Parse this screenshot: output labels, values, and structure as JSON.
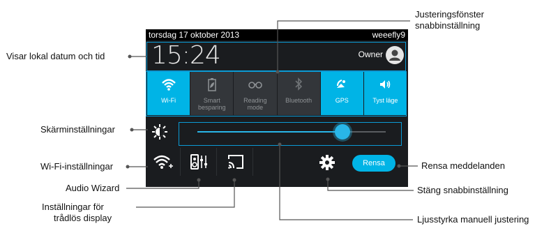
{
  "status_bar": {
    "date": "torsdag 17 oktober 2013",
    "network": "weeefly9"
  },
  "header": {
    "time": "15:24",
    "user": "Owner"
  },
  "tiles": [
    {
      "label": "Wi-Fi",
      "on": true,
      "icon": "wifi-icon"
    },
    {
      "label": "Smart besparing",
      "on": false,
      "icon": "battery-leaf-icon"
    },
    {
      "label": "Reading mode",
      "on": false,
      "icon": "glasses-icon"
    },
    {
      "label": "Bluetooth",
      "on": false,
      "icon": "bluetooth-icon"
    },
    {
      "label": "GPS",
      "on": true,
      "icon": "gps-icon"
    },
    {
      "label": "Tyst läge",
      "on": true,
      "icon": "speaker-icon"
    }
  ],
  "brightness": {
    "level": 0.77
  },
  "toolbar": {
    "clear_label": "Rensa"
  },
  "callouts": {
    "date_time": "Visar lokal datum och tid",
    "adjust_window": [
      "Justeringsfönster",
      "snabbinställning"
    ],
    "screen_settings": "Skärminställningar",
    "wifi_settings": "Wi-Fi-inställningar",
    "audio_wizard": "Audio Wizard",
    "wireless_display": [
      "Inställningar för",
      "trådlös display"
    ],
    "clear_notifications": "Rensa meddelanden",
    "close_quick": "Stäng snabbinställning",
    "brightness_manual": "Ljusstyrka manuell justering"
  },
  "colors": {
    "accent": "#00b4e6",
    "annotation": "#0b9bd6"
  }
}
